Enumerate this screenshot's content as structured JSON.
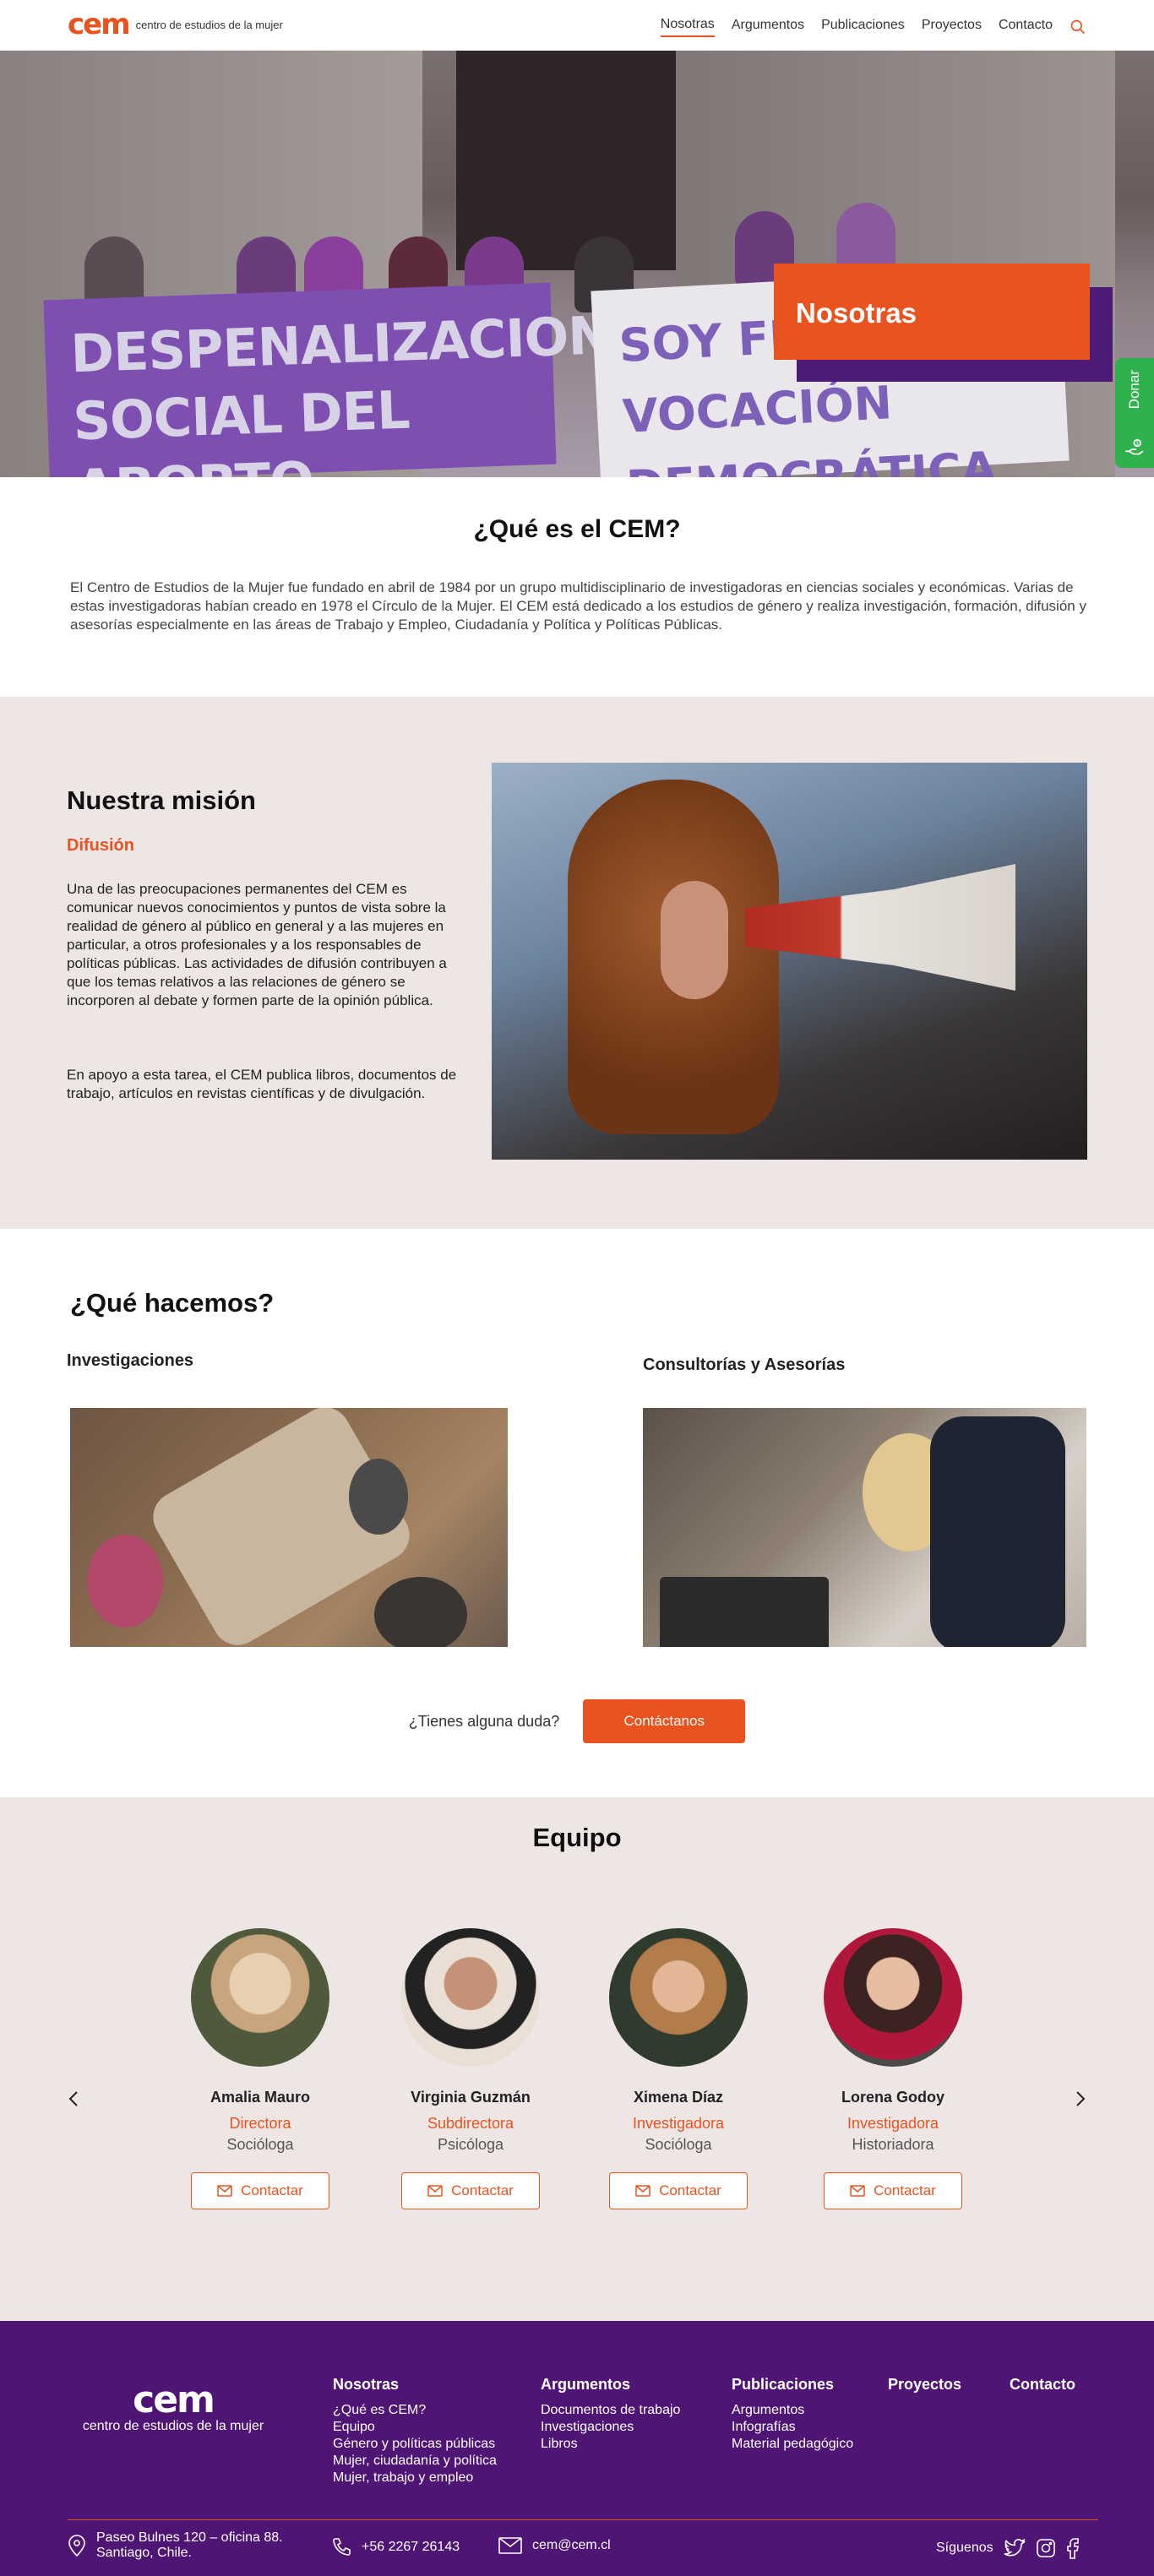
{
  "header": {
    "logo_mark": "cem",
    "logo_text": "centro de estudios de la mujer",
    "nav": [
      "Nosotras",
      "Argumentos",
      "Publicaciones",
      "Proyectos",
      "Contacto"
    ]
  },
  "hero": {
    "banner_left": "DESPENALIZACION SOCIAL DEL ABORTO",
    "banner_right": "SOY FEMINISTA VOCACIÓN DEMOCRÁTICA",
    "title": "Nosotras",
    "donate_label": "Donar"
  },
  "about": {
    "title": "¿Qué es el CEM?",
    "text": "El Centro de Estudios de la Mujer fue fundado en abril de 1984 por un grupo multidisciplinario de investigadoras en ciencias sociales y económicas. Varias de estas investigadoras habían creado en 1978 el Círculo de la Mujer. El CEM está dedicado a los estudios de género y realiza investigación, formación, difusión y asesorías especialmente en las áreas de Trabajo y Empleo, Ciudadanía y Política y Políticas Públicas."
  },
  "mission": {
    "title": "Nuestra misión",
    "subtitle": "Difusión",
    "p1": "Una de las preocupaciones permanentes del CEM es comunicar nuevos conocimientos y puntos de vista sobre la realidad de género al público en general y a las mujeres en particular, a otros profesionales y a los responsables de políticas públicas. Las actividades de difusión contribuyen a que los temas relativos a las relaciones de género se incorporen al debate y formen parte de la opinión pública.",
    "p2": "En apoyo a esta tarea, el CEM publica libros, documentos de trabajo, artículos en revistas científicas y de divulgación."
  },
  "whatwe": {
    "title": "¿Qué hacemos?",
    "col1": "Investigaciones",
    "col2": "Consultorías y Asesorías",
    "question": "¿Tienes alguna duda?",
    "button": "Contáctanos"
  },
  "team": {
    "title": "Equipo",
    "members": [
      {
        "name": "Amalia Mauro",
        "role": "Directora",
        "profession": "Socióloga",
        "button": "Contactar"
      },
      {
        "name": "Virginia Guzmán",
        "role": "Subdirectora",
        "profession": "Psicóloga",
        "button": "Contactar"
      },
      {
        "name": "Ximena Díaz",
        "role": "Investigadora",
        "profession": "Socióloga",
        "button": "Contactar"
      },
      {
        "name": "Lorena Godoy",
        "role": "Investigadora",
        "profession": "Historiadora",
        "button": "Contactar"
      }
    ]
  },
  "footer": {
    "logo_mark": "cem",
    "logo_text": "centro de estudios de la mujer",
    "columns": [
      {
        "title": "Nosotras",
        "items": [
          "¿Qué es CEM?",
          "Equipo",
          "Género y políticas públicas",
          "Mujer, ciudadanía y política",
          "Mujer, trabajo y empleo"
        ]
      },
      {
        "title": "Argumentos",
        "items": [
          "Documentos de trabajo",
          "Investigaciones",
          "Libros"
        ]
      },
      {
        "title": "Publicaciones",
        "items": [
          "Argumentos",
          "Infografías",
          "Material pedagógico"
        ]
      },
      {
        "title": "Proyectos",
        "items": []
      },
      {
        "title": "Contacto",
        "items": []
      }
    ],
    "address_line1": "Paseo Bulnes 120 – oficina 88.",
    "address_line2": "Santiago, Chile.",
    "phone": "+56 2267 26143",
    "email": "cem@cem.cl",
    "follow": "Síguenos"
  },
  "colors": {
    "accent": "#e8531f",
    "purple": "#4e1574",
    "green": "#2fb14e",
    "beige": "#ede6e5"
  }
}
